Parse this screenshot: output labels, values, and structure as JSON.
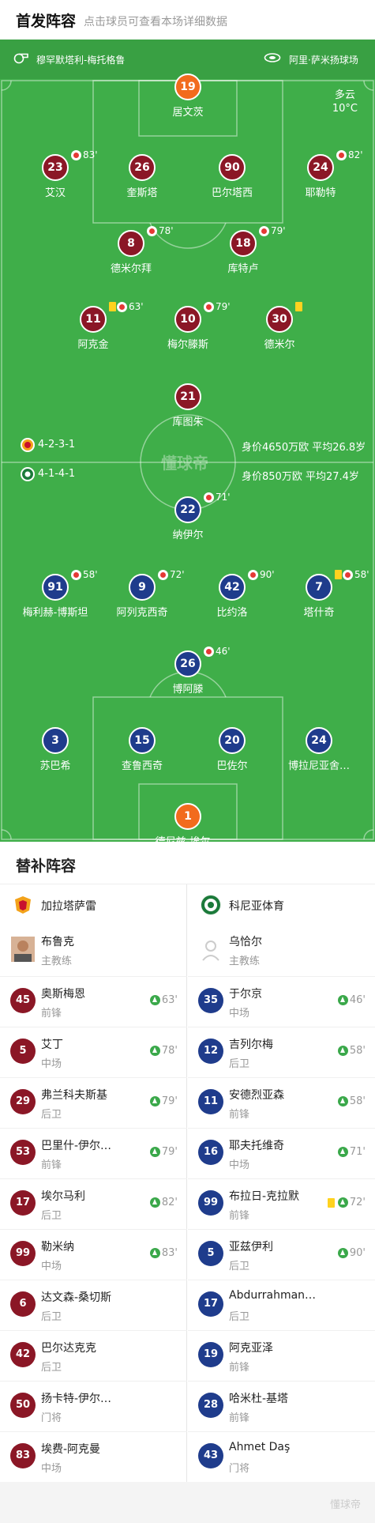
{
  "header": {
    "title": "首发阵容",
    "subtitle": "点击球员可查看本场详细数据"
  },
  "match": {
    "referee": "穆罕默塔利-梅托格鲁",
    "stadium": "阿里·萨米扬球场",
    "weather": "多云",
    "temperature": "10°C",
    "watermark": "懂球帝"
  },
  "home": {
    "name": "加拉塔萨雷",
    "formation": "4-2-3-1",
    "value_text": "身价4650万欧  平均26.8岁",
    "coach": {
      "name": "布鲁克",
      "role": "主教练"
    },
    "lineup": [
      {
        "num": "19",
        "name": "居文茨",
        "sub_time": "",
        "yellow": false,
        "gk": true
      },
      {
        "num": "23",
        "name": "艾汉",
        "sub_time": "83'",
        "yellow": false
      },
      {
        "num": "26",
        "name": "奎斯塔",
        "sub_time": "",
        "yellow": false
      },
      {
        "num": "90",
        "name": "巴尔塔西",
        "sub_time": "",
        "yellow": false
      },
      {
        "num": "24",
        "name": "耶勒特",
        "sub_time": "82'",
        "yellow": false
      },
      {
        "num": "8",
        "name": "德米尔拜",
        "sub_time": "78'",
        "yellow": false
      },
      {
        "num": "18",
        "name": "库特卢",
        "sub_time": "79'",
        "yellow": false
      },
      {
        "num": "11",
        "name": "阿克金",
        "sub_time": "63'",
        "yellow": true
      },
      {
        "num": "10",
        "name": "梅尔滕斯",
        "sub_time": "79'",
        "yellow": false
      },
      {
        "num": "30",
        "name": "德米尔",
        "sub_time": "",
        "yellow": true
      },
      {
        "num": "21",
        "name": "库图朱",
        "sub_time": "",
        "yellow": false
      }
    ],
    "subs": [
      {
        "num": "45",
        "name": "奥斯梅恩",
        "pos": "前锋",
        "in": "63'",
        "yellow": false
      },
      {
        "num": "5",
        "name": "艾丁",
        "pos": "中场",
        "in": "78'",
        "yellow": false
      },
      {
        "num": "29",
        "name": "弗兰科夫斯基",
        "pos": "后卫",
        "in": "79'",
        "yellow": false
      },
      {
        "num": "53",
        "name": "巴里什-伊尔…",
        "pos": "前锋",
        "in": "79'",
        "yellow": false
      },
      {
        "num": "17",
        "name": "埃尔马利",
        "pos": "后卫",
        "in": "82'",
        "yellow": false
      },
      {
        "num": "99",
        "name": "勒米纳",
        "pos": "中场",
        "in": "83'",
        "yellow": false
      },
      {
        "num": "6",
        "name": "达文森-桑切斯",
        "pos": "后卫",
        "in": "",
        "yellow": false
      },
      {
        "num": "42",
        "name": "巴尔达克克",
        "pos": "后卫",
        "in": "",
        "yellow": false
      },
      {
        "num": "50",
        "name": "扬卡特-伊尔…",
        "pos": "门将",
        "in": "",
        "yellow": false
      },
      {
        "num": "83",
        "name": "埃费-阿克曼",
        "pos": "中场",
        "in": "",
        "yellow": false
      }
    ]
  },
  "away": {
    "name": "科尼亚体育",
    "formation": "4-1-4-1",
    "value_text": "身价850万欧  平均27.4岁",
    "coach": {
      "name": "乌恰尔",
      "role": "主教练"
    },
    "lineup": [
      {
        "num": "22",
        "name": "纳伊尔",
        "sub_time": "71'",
        "yellow": false
      },
      {
        "num": "91",
        "name": "梅利赫-博斯坦",
        "sub_time": "58'",
        "yellow": false
      },
      {
        "num": "9",
        "name": "阿列克西奇",
        "sub_time": "72'",
        "yellow": false
      },
      {
        "num": "42",
        "name": "比约洛",
        "sub_time": "90'",
        "yellow": false
      },
      {
        "num": "7",
        "name": "塔什奇",
        "sub_time": "58'",
        "yellow": true
      },
      {
        "num": "26",
        "name": "博阿滕",
        "sub_time": "46'",
        "yellow": false
      },
      {
        "num": "3",
        "name": "苏巴希",
        "sub_time": "",
        "yellow": false
      },
      {
        "num": "15",
        "name": "查鲁西奇",
        "sub_time": "",
        "yellow": false
      },
      {
        "num": "20",
        "name": "巴佐尔",
        "sub_time": "",
        "yellow": false
      },
      {
        "num": "24",
        "name": "博拉尼亚舍…",
        "sub_time": "",
        "yellow": false
      },
      {
        "num": "1",
        "name": "德尼兹-埃尔…",
        "sub_time": "",
        "yellow": false,
        "gk": true
      }
    ],
    "subs": [
      {
        "num": "35",
        "name": "于尔京",
        "pos": "中场",
        "in": "46'",
        "yellow": false
      },
      {
        "num": "12",
        "name": "吉列尔梅",
        "pos": "后卫",
        "in": "58'",
        "yellow": false
      },
      {
        "num": "11",
        "name": "安德烈亚森",
        "pos": "前锋",
        "in": "58'",
        "yellow": false
      },
      {
        "num": "16",
        "name": "耶夫托维奇",
        "pos": "中场",
        "in": "71'",
        "yellow": false
      },
      {
        "num": "99",
        "name": "布拉日-克拉默",
        "pos": "前锋",
        "in": "72'",
        "yellow": true
      },
      {
        "num": "5",
        "name": "亚兹伊利",
        "pos": "后卫",
        "in": "90'",
        "yellow": false
      },
      {
        "num": "17",
        "name": "Abdurrahman…",
        "pos": "后卫",
        "in": "",
        "yellow": false
      },
      {
        "num": "19",
        "name": "阿克亚泽",
        "pos": "前锋",
        "in": "",
        "yellow": false
      },
      {
        "num": "28",
        "name": "哈米杜-基塔",
        "pos": "前锋",
        "in": "",
        "yellow": false
      },
      {
        "num": "43",
        "name": "Ahmet Daş",
        "pos": "门将",
        "in": "",
        "yellow": false
      }
    ]
  },
  "subs_title": "替补阵容",
  "footer_watermark": "懂球帝",
  "colors": {
    "pitch": "#3fae49",
    "home": "#8b1726",
    "away": "#1f3c8c",
    "gk": "#f26b1d",
    "sub_in": "#3aa84a",
    "yellow_card": "#ffd21f"
  }
}
